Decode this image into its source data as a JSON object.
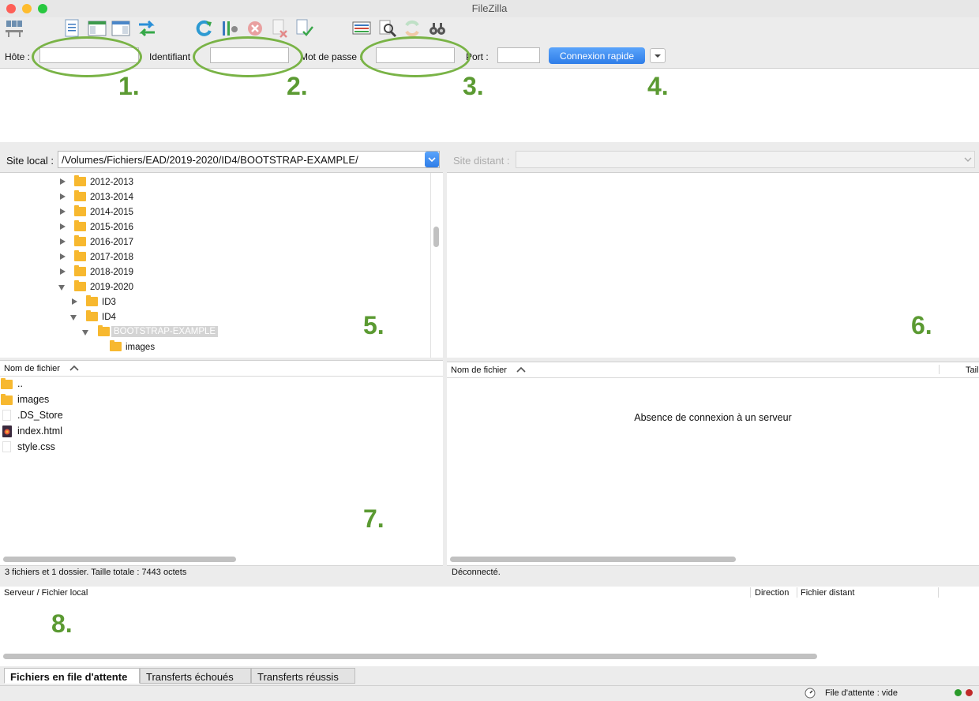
{
  "window": {
    "title": "FileZilla"
  },
  "quickconnect": {
    "host_label": "Hôte :",
    "user_label": "Identifiant :",
    "pass_label": "Mot de passe :",
    "port_label": "Port :",
    "connect_label": "Connexion rapide"
  },
  "annotations": [
    "1.",
    "2.",
    "3.",
    "4.",
    "5.",
    "6.",
    "7.",
    "8."
  ],
  "local_site": {
    "label": "Site local :",
    "path": "/Volumes/Fichiers/EAD/2019-2020/ID4/BOOTSTRAP-EXAMPLE/",
    "tree": [
      {
        "name": "2012-2013",
        "state": "collapsed"
      },
      {
        "name": "2013-2014",
        "state": "collapsed"
      },
      {
        "name": "2014-2015",
        "state": "collapsed"
      },
      {
        "name": "2015-2016",
        "state": "collapsed"
      },
      {
        "name": "2016-2017",
        "state": "collapsed"
      },
      {
        "name": "2017-2018",
        "state": "collapsed"
      },
      {
        "name": "2018-2019",
        "state": "collapsed"
      },
      {
        "name": "2019-2020",
        "state": "expanded"
      },
      {
        "name": "ID3",
        "state": "collapsed"
      },
      {
        "name": "ID4",
        "state": "expanded"
      },
      {
        "name": "BOOTSTRAP-EXAMPLE",
        "state": "expanded-selected"
      },
      {
        "name": "images",
        "state": "leaf"
      }
    ],
    "list_header": "Nom de fichier",
    "files": [
      {
        "name": "..",
        "icon": "folder-icon"
      },
      {
        "name": "images",
        "icon": "folder-icon"
      },
      {
        "name": ".DS_Store",
        "icon": "file-icon"
      },
      {
        "name": "index.html",
        "icon": "html-file-icon"
      },
      {
        "name": "style.css",
        "icon": "file-icon"
      }
    ],
    "status": "3 fichiers et 1 dossier. Taille totale : 7443 octets"
  },
  "remote_site": {
    "label": "Site distant :",
    "list_header": "Nom de fichier",
    "list_header_2": "Tail",
    "empty_message": "Absence de connexion à un serveur",
    "status": "Déconnecté."
  },
  "queue": {
    "col_server": "Serveur / Fichier local",
    "col_direction": "Direction",
    "col_remote": "Fichier distant",
    "tabs": [
      "Fichiers en file d'attente",
      "Transferts échoués",
      "Transferts réussis"
    ],
    "status": "File d'attente : vide"
  },
  "colors": {
    "accent": "#2f7de8",
    "annotation": "#79b346"
  }
}
